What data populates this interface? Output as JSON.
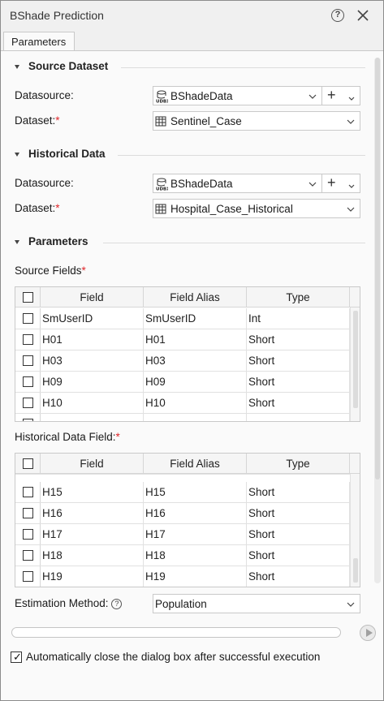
{
  "window": {
    "title": "BShade Prediction"
  },
  "tabs": [
    {
      "label": "Parameters"
    }
  ],
  "source_dataset": {
    "title": "Source Dataset",
    "datasource_label": "Datasource:",
    "datasource_value": "BShadeData",
    "dataset_label": "Dataset:",
    "dataset_value": "Sentinel_Case"
  },
  "historical_data": {
    "title": "Historical Data",
    "datasource_label": "Datasource:",
    "datasource_value": "BShadeData",
    "dataset_label": "Dataset:",
    "dataset_value": "Hospital_Case_Historical"
  },
  "parameters": {
    "title": "Parameters",
    "source_fields_label": "Source Fields",
    "historical_field_label": "Historical Data Field:",
    "estimation_method_label": "Estimation Method:",
    "estimation_method_value": "Population"
  },
  "required_mark": "*",
  "table_headers": {
    "field": "Field",
    "alias": "Field Alias",
    "type": "Type"
  },
  "source_rows": [
    {
      "field": "SmUserID",
      "alias": "SmUserID",
      "type": "Int"
    },
    {
      "field": "H01",
      "alias": "H01",
      "type": "Short"
    },
    {
      "field": "H03",
      "alias": "H03",
      "type": "Short"
    },
    {
      "field": "H09",
      "alias": "H09",
      "type": "Short"
    },
    {
      "field": "H10",
      "alias": "H10",
      "type": "Short"
    }
  ],
  "historical_rows": [
    {
      "field": "H15",
      "alias": "H15",
      "type": "Short"
    },
    {
      "field": "H16",
      "alias": "H16",
      "type": "Short"
    },
    {
      "field": "H17",
      "alias": "H17",
      "type": "Short"
    },
    {
      "field": "H18",
      "alias": "H18",
      "type": "Short"
    },
    {
      "field": "H19",
      "alias": "H19",
      "type": "Short"
    }
  ],
  "footer": {
    "auto_close_label": "Automatically close the dialog box after successful execution",
    "auto_close_checked": true,
    "progress": 0
  },
  "icons": {
    "help": "help-icon",
    "close": "close-icon",
    "datasource": "udbx-datasource-icon",
    "dataset": "table-dataset-icon",
    "add": "plus-icon",
    "dropdown": "chevron-down-icon",
    "run": "play-icon"
  }
}
